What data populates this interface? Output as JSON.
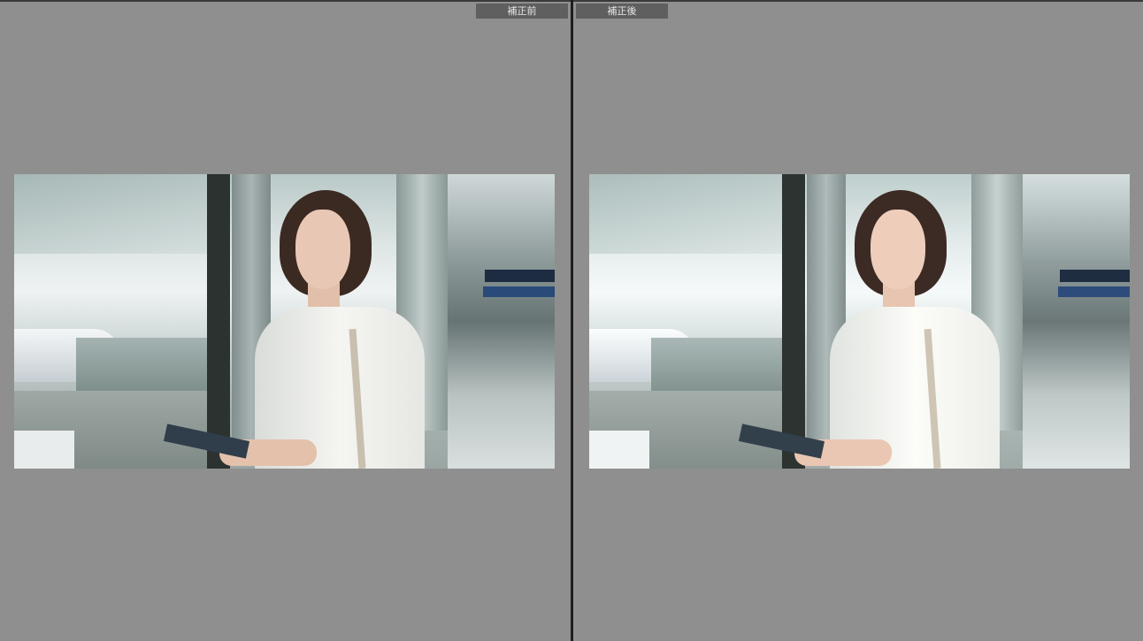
{
  "compare_view": {
    "before": {
      "label": "補正前"
    },
    "after": {
      "label": "補正後"
    }
  }
}
